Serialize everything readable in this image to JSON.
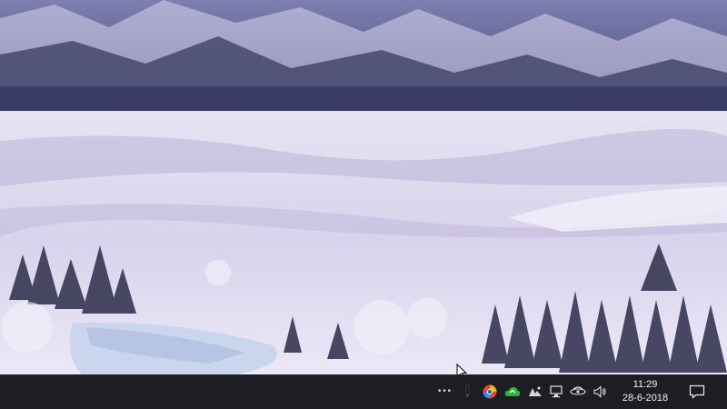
{
  "wallpaper": {
    "description_colors": {
      "sky_mountain": "#5a5a8e",
      "snow": "#e8e4f4",
      "lake": "#c7d3ec",
      "trees": "#3a3a5a"
    }
  },
  "taskbar": {
    "background": "#1d1d24",
    "overflow_label": "•••",
    "tray_icons": [
      "pen-tablet-icon",
      "browser-app-icon",
      "cloud-sync-icon",
      "app-tray-icon",
      "network-icon",
      "syncing-app-icon",
      "volume-icon"
    ],
    "clock": {
      "time": "11:29",
      "date": "28-6-2018"
    },
    "notification_icon": "action-center-icon"
  }
}
